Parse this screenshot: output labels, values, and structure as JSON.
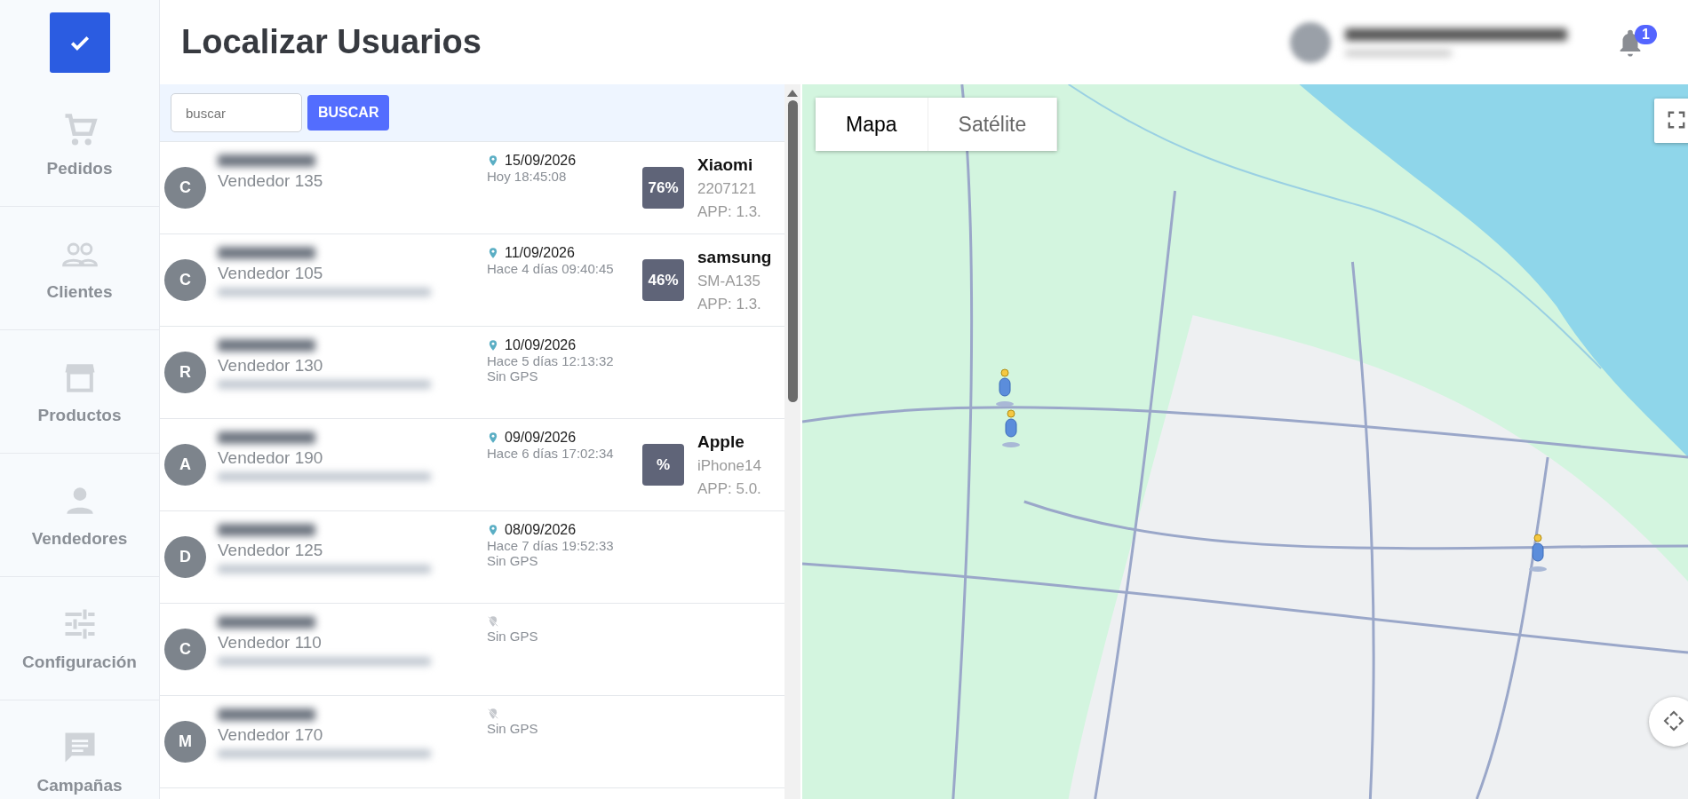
{
  "sidebar": {
    "items": [
      {
        "kind": "cart",
        "label": "Pedidos"
      },
      {
        "kind": "people",
        "label": "Clientes"
      },
      {
        "kind": "store",
        "label": "Productos"
      },
      {
        "kind": "person",
        "label": "Vendedores"
      },
      {
        "kind": "sliders",
        "label": "Configuración"
      },
      {
        "kind": "chat",
        "label": "Campañas"
      }
    ]
  },
  "header": {
    "title": "Localizar Usuarios",
    "notifications": "1"
  },
  "search": {
    "placeholder": "buscar",
    "button": "BUSCAR"
  },
  "users": [
    {
      "initial": "C",
      "role": "Vendedor 135",
      "address_blurred": false,
      "located": true,
      "date": "15/09/2026",
      "time": "Hoy 18:45:08",
      "battery": "76%",
      "brand": "Xiaomi",
      "model": "2207121",
      "app": "APP: 1.3."
    },
    {
      "initial": "C",
      "role": "Vendedor 105",
      "address_blurred": true,
      "located": true,
      "date": "11/09/2026",
      "time": "Hace 4 días 09:40:45",
      "battery": "46%",
      "brand": "samsung",
      "model": "SM-A135",
      "app": "APP: 1.3."
    },
    {
      "initial": "R",
      "role": "Vendedor 130",
      "address_blurred": true,
      "located": true,
      "date": "10/09/2026",
      "time": "Hace 5 días 12:13:32",
      "gps_note": "Sin GPS"
    },
    {
      "initial": "A",
      "role": "Vendedor 190",
      "address_blurred": true,
      "located": true,
      "date": "09/09/2026",
      "time": "Hace 6 días 17:02:34",
      "battery": "%",
      "brand": "Apple",
      "model": "iPhone14",
      "app": "APP: 5.0."
    },
    {
      "initial": "D",
      "role": "Vendedor 125",
      "address_blurred": true,
      "located": true,
      "date": "08/09/2026",
      "time": "Hace 7 días 19:52:33",
      "gps_note": "Sin GPS"
    },
    {
      "initial": "C",
      "role": "Vendedor 110",
      "address_blurred": true,
      "located": false,
      "gps_note": "Sin GPS"
    },
    {
      "initial": "M",
      "role": "Vendedor 170",
      "address_blurred": true,
      "located": false,
      "gps_note": "Sin GPS"
    }
  ],
  "map": {
    "types": [
      {
        "label": "Mapa",
        "selected": true
      },
      {
        "label": "Satélite",
        "selected": false
      }
    ]
  }
}
